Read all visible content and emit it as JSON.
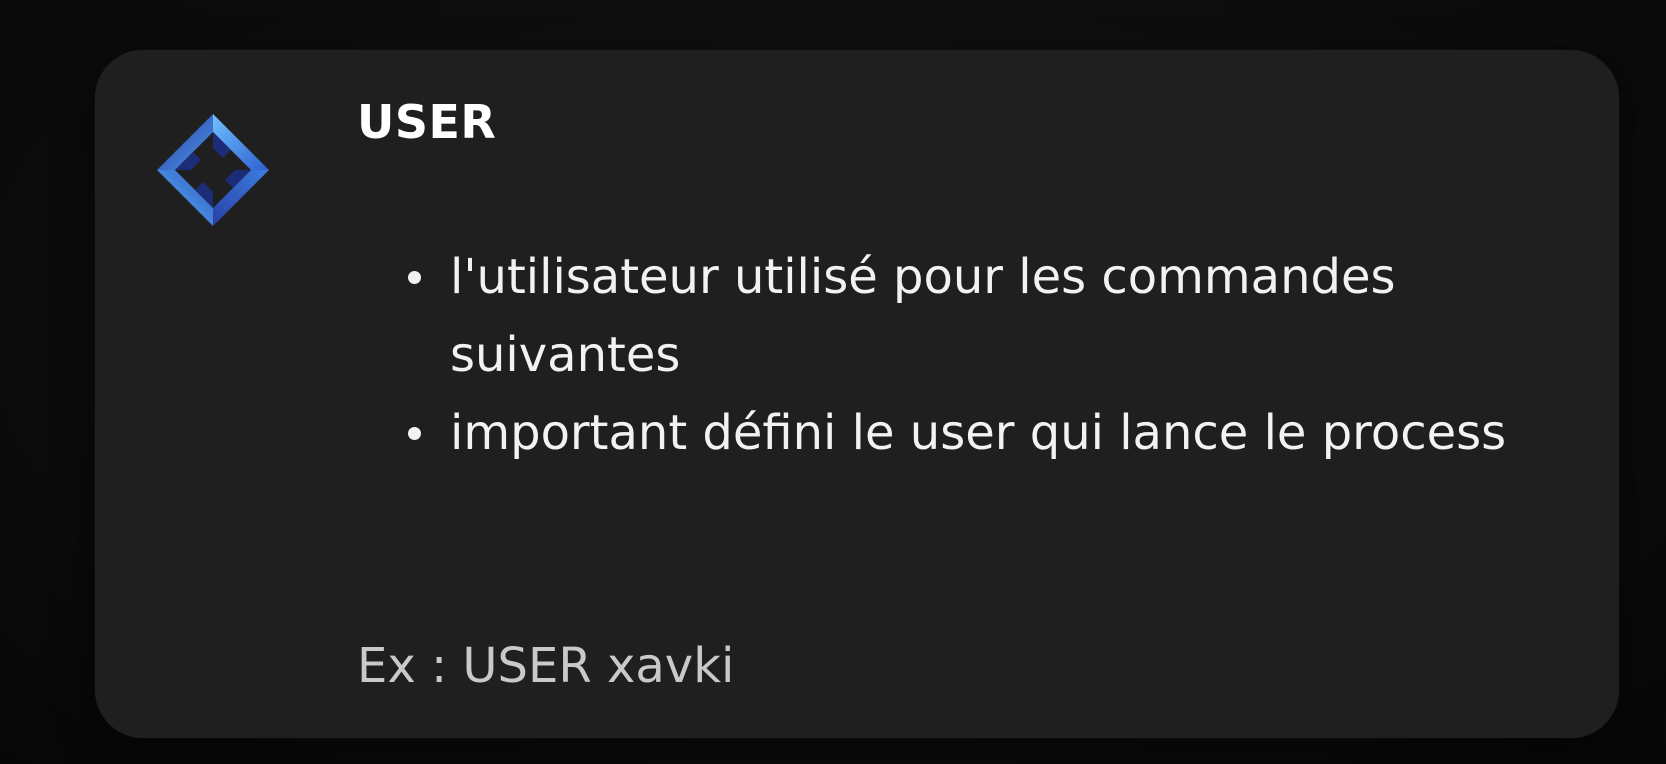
{
  "slide": {
    "title": "USER",
    "bullets": [
      "l'utilisateur utilisé pour les commandes suivantes",
      "important défini le user qui lance le process"
    ],
    "example": "Ex : USER xavki"
  },
  "logo": {
    "icon": "diamond-logo-icon",
    "colors": [
      "#5aa8f0",
      "#2f6fd6",
      "#2a3fa8"
    ]
  }
}
